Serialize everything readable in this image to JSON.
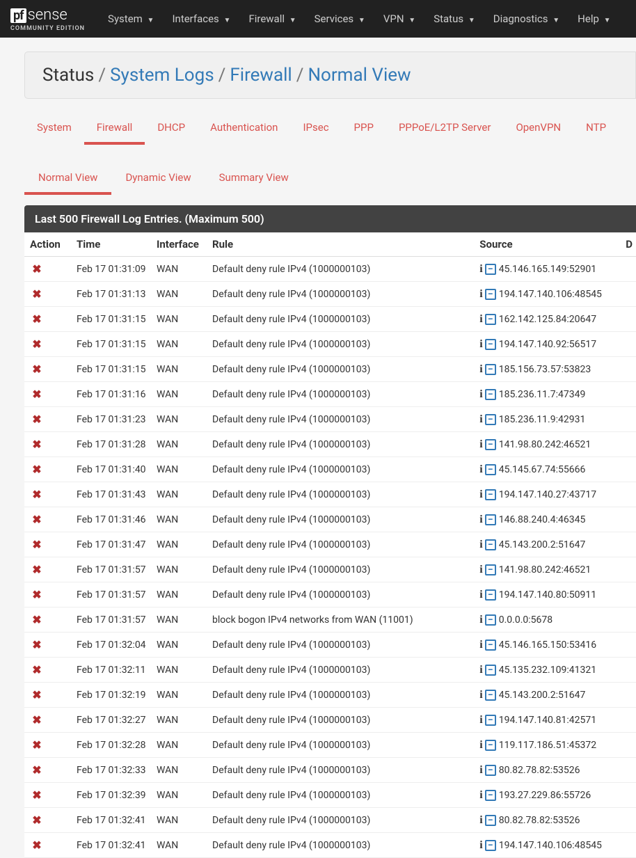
{
  "brand": {
    "pf": "pf",
    "sense": "sense",
    "sub": "COMMUNITY EDITION"
  },
  "nav": [
    "System",
    "Interfaces",
    "Firewall",
    "Services",
    "VPN",
    "Status",
    "Diagnostics",
    "Help"
  ],
  "breadcrumb": [
    {
      "text": "Status",
      "link": false
    },
    {
      "text": "System Logs",
      "link": true
    },
    {
      "text": "Firewall",
      "link": true
    },
    {
      "text": "Normal View",
      "link": true
    }
  ],
  "tabs": [
    {
      "label": "System",
      "active": false
    },
    {
      "label": "Firewall",
      "active": true
    },
    {
      "label": "DHCP",
      "active": false
    },
    {
      "label": "Authentication",
      "active": false
    },
    {
      "label": "IPsec",
      "active": false
    },
    {
      "label": "PPP",
      "active": false
    },
    {
      "label": "PPPoE/L2TP Server",
      "active": false
    },
    {
      "label": "OpenVPN",
      "active": false
    },
    {
      "label": "NTP",
      "active": false
    }
  ],
  "subtabs": [
    {
      "label": "Normal View",
      "active": true
    },
    {
      "label": "Dynamic View",
      "active": false
    },
    {
      "label": "Summary View",
      "active": false
    }
  ],
  "panel_title": "Last 500 Firewall Log Entries. (Maximum 500)",
  "columns": [
    "Action",
    "Time",
    "Interface",
    "Rule",
    "Source",
    "D"
  ],
  "rows": [
    {
      "time": "Feb 17 01:31:09",
      "if": "WAN",
      "rule": "Default deny rule IPv4 (1000000103)",
      "src": "45.146.165.149:52901"
    },
    {
      "time": "Feb 17 01:31:13",
      "if": "WAN",
      "rule": "Default deny rule IPv4 (1000000103)",
      "src": "194.147.140.106:48545"
    },
    {
      "time": "Feb 17 01:31:15",
      "if": "WAN",
      "rule": "Default deny rule IPv4 (1000000103)",
      "src": "162.142.125.84:20647"
    },
    {
      "time": "Feb 17 01:31:15",
      "if": "WAN",
      "rule": "Default deny rule IPv4 (1000000103)",
      "src": "194.147.140.92:56517"
    },
    {
      "time": "Feb 17 01:31:15",
      "if": "WAN",
      "rule": "Default deny rule IPv4 (1000000103)",
      "src": "185.156.73.57:53823"
    },
    {
      "time": "Feb 17 01:31:16",
      "if": "WAN",
      "rule": "Default deny rule IPv4 (1000000103)",
      "src": "185.236.11.7:47349"
    },
    {
      "time": "Feb 17 01:31:23",
      "if": "WAN",
      "rule": "Default deny rule IPv4 (1000000103)",
      "src": "185.236.11.9:42931"
    },
    {
      "time": "Feb 17 01:31:28",
      "if": "WAN",
      "rule": "Default deny rule IPv4 (1000000103)",
      "src": "141.98.80.242:46521"
    },
    {
      "time": "Feb 17 01:31:40",
      "if": "WAN",
      "rule": "Default deny rule IPv4 (1000000103)",
      "src": "45.145.67.74:55666"
    },
    {
      "time": "Feb 17 01:31:43",
      "if": "WAN",
      "rule": "Default deny rule IPv4 (1000000103)",
      "src": "194.147.140.27:43717"
    },
    {
      "time": "Feb 17 01:31:46",
      "if": "WAN",
      "rule": "Default deny rule IPv4 (1000000103)",
      "src": "146.88.240.4:46345"
    },
    {
      "time": "Feb 17 01:31:47",
      "if": "WAN",
      "rule": "Default deny rule IPv4 (1000000103)",
      "src": "45.143.200.2:51647"
    },
    {
      "time": "Feb 17 01:31:57",
      "if": "WAN",
      "rule": "Default deny rule IPv4 (1000000103)",
      "src": "141.98.80.242:46521"
    },
    {
      "time": "Feb 17 01:31:57",
      "if": "WAN",
      "rule": "Default deny rule IPv4 (1000000103)",
      "src": "194.147.140.80:50911"
    },
    {
      "time": "Feb 17 01:31:57",
      "if": "WAN",
      "rule": "block bogon IPv4 networks from WAN (11001)",
      "src": "0.0.0.0:5678"
    },
    {
      "time": "Feb 17 01:32:04",
      "if": "WAN",
      "rule": "Default deny rule IPv4 (1000000103)",
      "src": "45.146.165.150:53416"
    },
    {
      "time": "Feb 17 01:32:11",
      "if": "WAN",
      "rule": "Default deny rule IPv4 (1000000103)",
      "src": "45.135.232.109:41321"
    },
    {
      "time": "Feb 17 01:32:19",
      "if": "WAN",
      "rule": "Default deny rule IPv4 (1000000103)",
      "src": "45.143.200.2:51647"
    },
    {
      "time": "Feb 17 01:32:27",
      "if": "WAN",
      "rule": "Default deny rule IPv4 (1000000103)",
      "src": "194.147.140.81:42571"
    },
    {
      "time": "Feb 17 01:32:28",
      "if": "WAN",
      "rule": "Default deny rule IPv4 (1000000103)",
      "src": "119.117.186.51:45372"
    },
    {
      "time": "Feb 17 01:32:33",
      "if": "WAN",
      "rule": "Default deny rule IPv4 (1000000103)",
      "src": "80.82.78.82:53526"
    },
    {
      "time": "Feb 17 01:32:39",
      "if": "WAN",
      "rule": "Default deny rule IPv4 (1000000103)",
      "src": "193.27.229.86:55726"
    },
    {
      "time": "Feb 17 01:32:41",
      "if": "WAN",
      "rule": "Default deny rule IPv4 (1000000103)",
      "src": "80.82.78.82:53526"
    },
    {
      "time": "Feb 17 01:32:41",
      "if": "WAN",
      "rule": "Default deny rule IPv4 (1000000103)",
      "src": "194.147.140.106:48545"
    }
  ]
}
